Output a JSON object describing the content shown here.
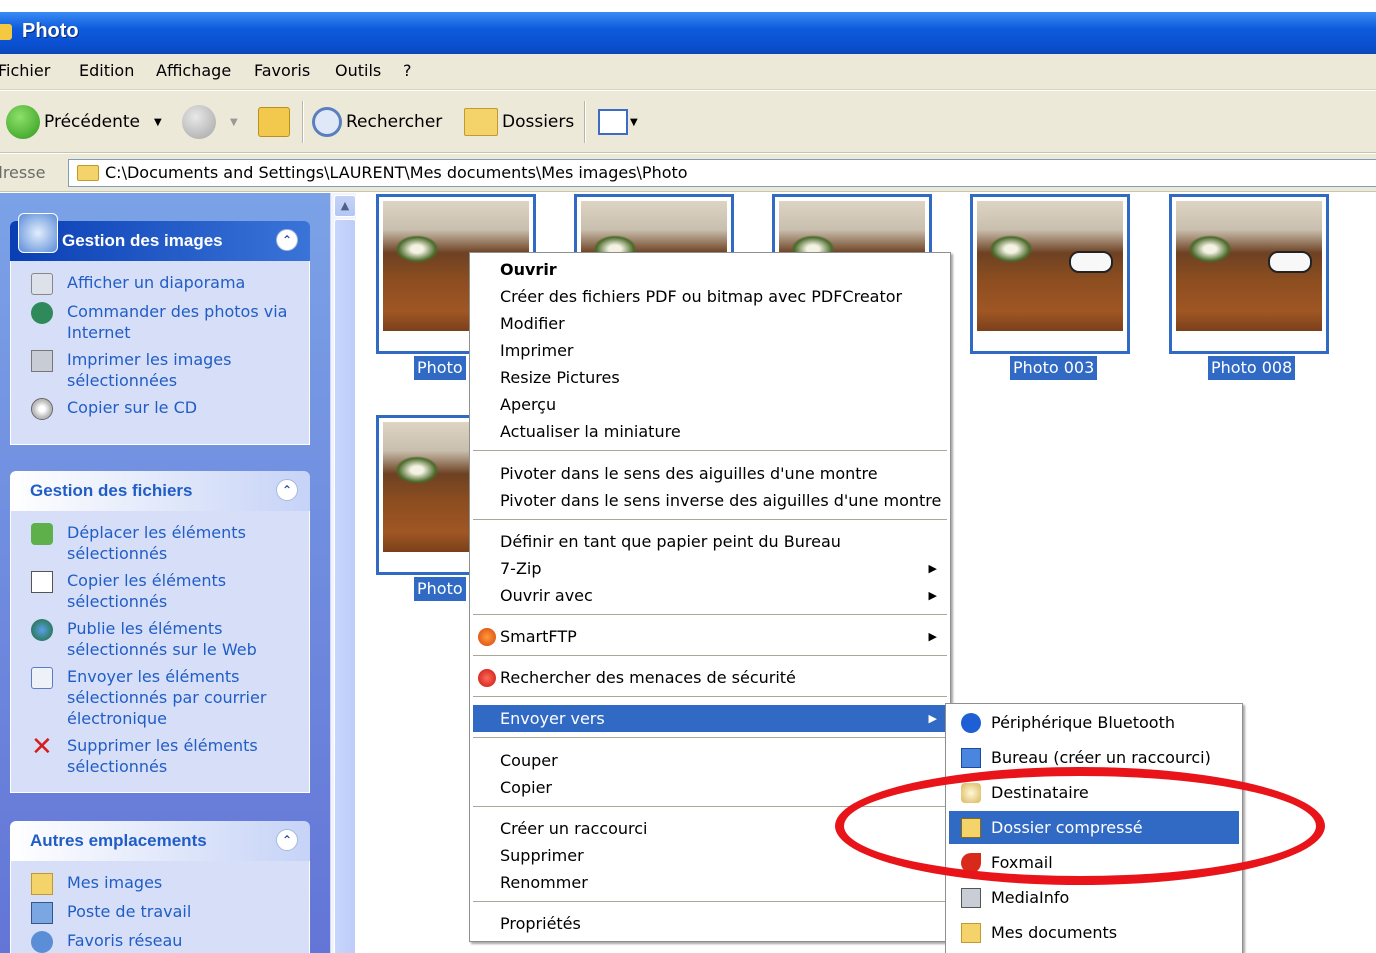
{
  "window": {
    "title": "Photo"
  },
  "menubar": [
    "Fichier",
    "Edition",
    "Affichage",
    "Favoris",
    "Outils",
    "?"
  ],
  "toolbar": {
    "back": "Précédente",
    "search": "Rechercher",
    "folders": "Dossiers"
  },
  "address": {
    "label": "Adresse",
    "path": "C:\\Documents and Settings\\LAURENT\\Mes documents\\Mes images\\Photo"
  },
  "sidepane": {
    "images": {
      "title": "Gestion des images",
      "links": [
        "Afficher un diaporama",
        "Commander des photos via Internet",
        "Imprimer les images sélectionnées",
        "Copier sur le CD"
      ]
    },
    "files": {
      "title": "Gestion des fichiers",
      "links": [
        "Déplacer les éléments sélectionnés",
        "Copier les éléments sélectionnés",
        "Publie les éléments sélectionnés sur le Web",
        "Envoyer les éléments sélectionnés par courrier électronique",
        "Supprimer les éléments sélectionnés"
      ]
    },
    "places": {
      "title": "Autres emplacements",
      "links": [
        "Mes images",
        "Poste de travail",
        "Favoris réseau"
      ]
    }
  },
  "thumbnails": [
    "Photo",
    "",
    "",
    "Photo 003",
    "Photo 008",
    "Photo"
  ],
  "context_menu": {
    "items": [
      "Ouvrir",
      "Créer des fichiers PDF ou bitmap avec PDFCreator",
      "Modifier",
      "Imprimer",
      "Resize Pictures",
      "Aperçu",
      "Actualiser la miniature",
      "Pivoter dans le sens des aiguilles d'une montre",
      "Pivoter dans le sens inverse des aiguilles d'une montre",
      "Définir en tant que papier peint du Bureau",
      "7-Zip",
      "Ouvrir avec",
      "SmartFTP",
      "Rechercher des menaces de sécurité",
      "Envoyer vers",
      "Couper",
      "Copier",
      "Créer un raccourci",
      "Supprimer",
      "Renommer",
      "Propriétés"
    ]
  },
  "submenu": {
    "items": [
      "Périphérique Bluetooth",
      "Bureau (créer un raccourci)",
      "Destinataire",
      "Dossier compressé",
      "Foxmail",
      "MediaInfo",
      "Mes documents"
    ]
  },
  "colors": {
    "selection": "#316ac5",
    "annotation_ring": "#e8141a",
    "titlebar": "#0a4fd0"
  }
}
